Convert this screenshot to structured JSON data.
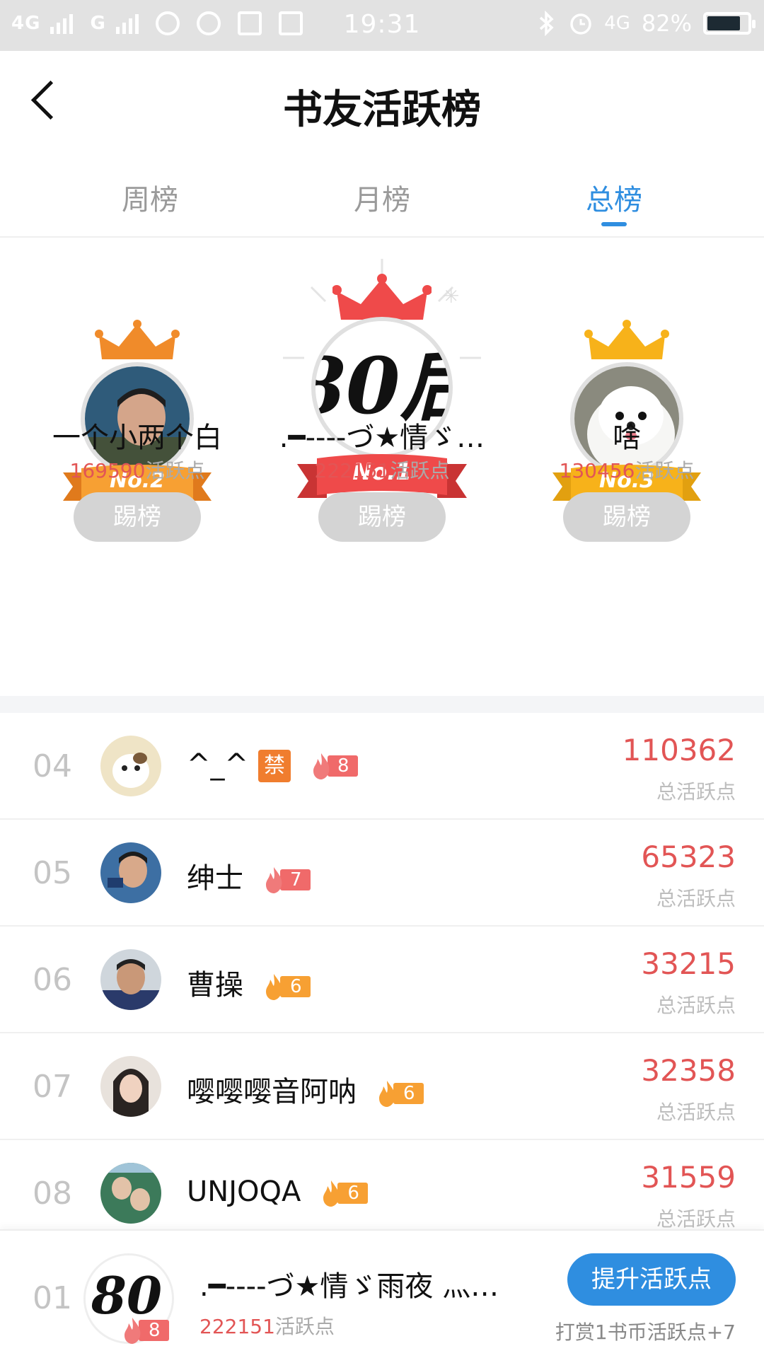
{
  "status_bar": {
    "left_signal_1": "4G",
    "left_signal_2": "G",
    "time": "19:31",
    "right_network": "4G",
    "battery_text": "82%",
    "battery_level": 0.82
  },
  "header": {
    "title": "书友活跃榜"
  },
  "tabs": [
    {
      "label": "周榜",
      "active": false
    },
    {
      "label": "月榜",
      "active": false
    },
    {
      "label": "总榜",
      "active": true
    }
  ],
  "podium": {
    "first": {
      "rank_label": "No.1",
      "name": ".━----づ★情ゞ…",
      "score": "222151",
      "unit": "活跃点",
      "button": "踢榜",
      "avatar_text": "80后"
    },
    "second": {
      "rank_label": "No.2",
      "name": "一个小两个白",
      "score": "169590",
      "unit": "活跃点",
      "button": "踢榜"
    },
    "third": {
      "rank_label": "No.3",
      "name": "啥",
      "score": "130456",
      "unit": "活跃点",
      "button": "踢榜"
    }
  },
  "list": [
    {
      "rank": "04",
      "name": "^_^",
      "ban_badge": "禁",
      "level": "8",
      "level_color": "red",
      "score": "110362",
      "score_label": "总活跃点"
    },
    {
      "rank": "05",
      "name": "绅士",
      "level": "7",
      "level_color": "red",
      "score": "65323",
      "score_label": "总活跃点"
    },
    {
      "rank": "06",
      "name": "曹操",
      "level": "6",
      "level_color": "orange",
      "score": "33215",
      "score_label": "总活跃点"
    },
    {
      "rank": "07",
      "name": "嘤嘤嘤音阿呐",
      "level": "6",
      "level_color": "orange",
      "score": "32358",
      "score_label": "总活跃点"
    },
    {
      "rank": "08",
      "name": "UNJOQA",
      "level": "6",
      "level_color": "orange",
      "score": "31559",
      "score_label": "总活跃点"
    }
  ],
  "me": {
    "rank": "01",
    "name": ".━----づ★情ゞ雨夜 灬…",
    "level": "8",
    "score": "222151",
    "unit": "活跃点",
    "button": "提升活跃点",
    "hint": "打赏1书币活跃点+7",
    "avatar_text": "80"
  },
  "colors": {
    "accent": "#2f8ee0",
    "score_red": "#e25555",
    "gold": "#f7b21a",
    "silver_orange": "#f08b2a",
    "first_red": "#ef4a4a"
  }
}
